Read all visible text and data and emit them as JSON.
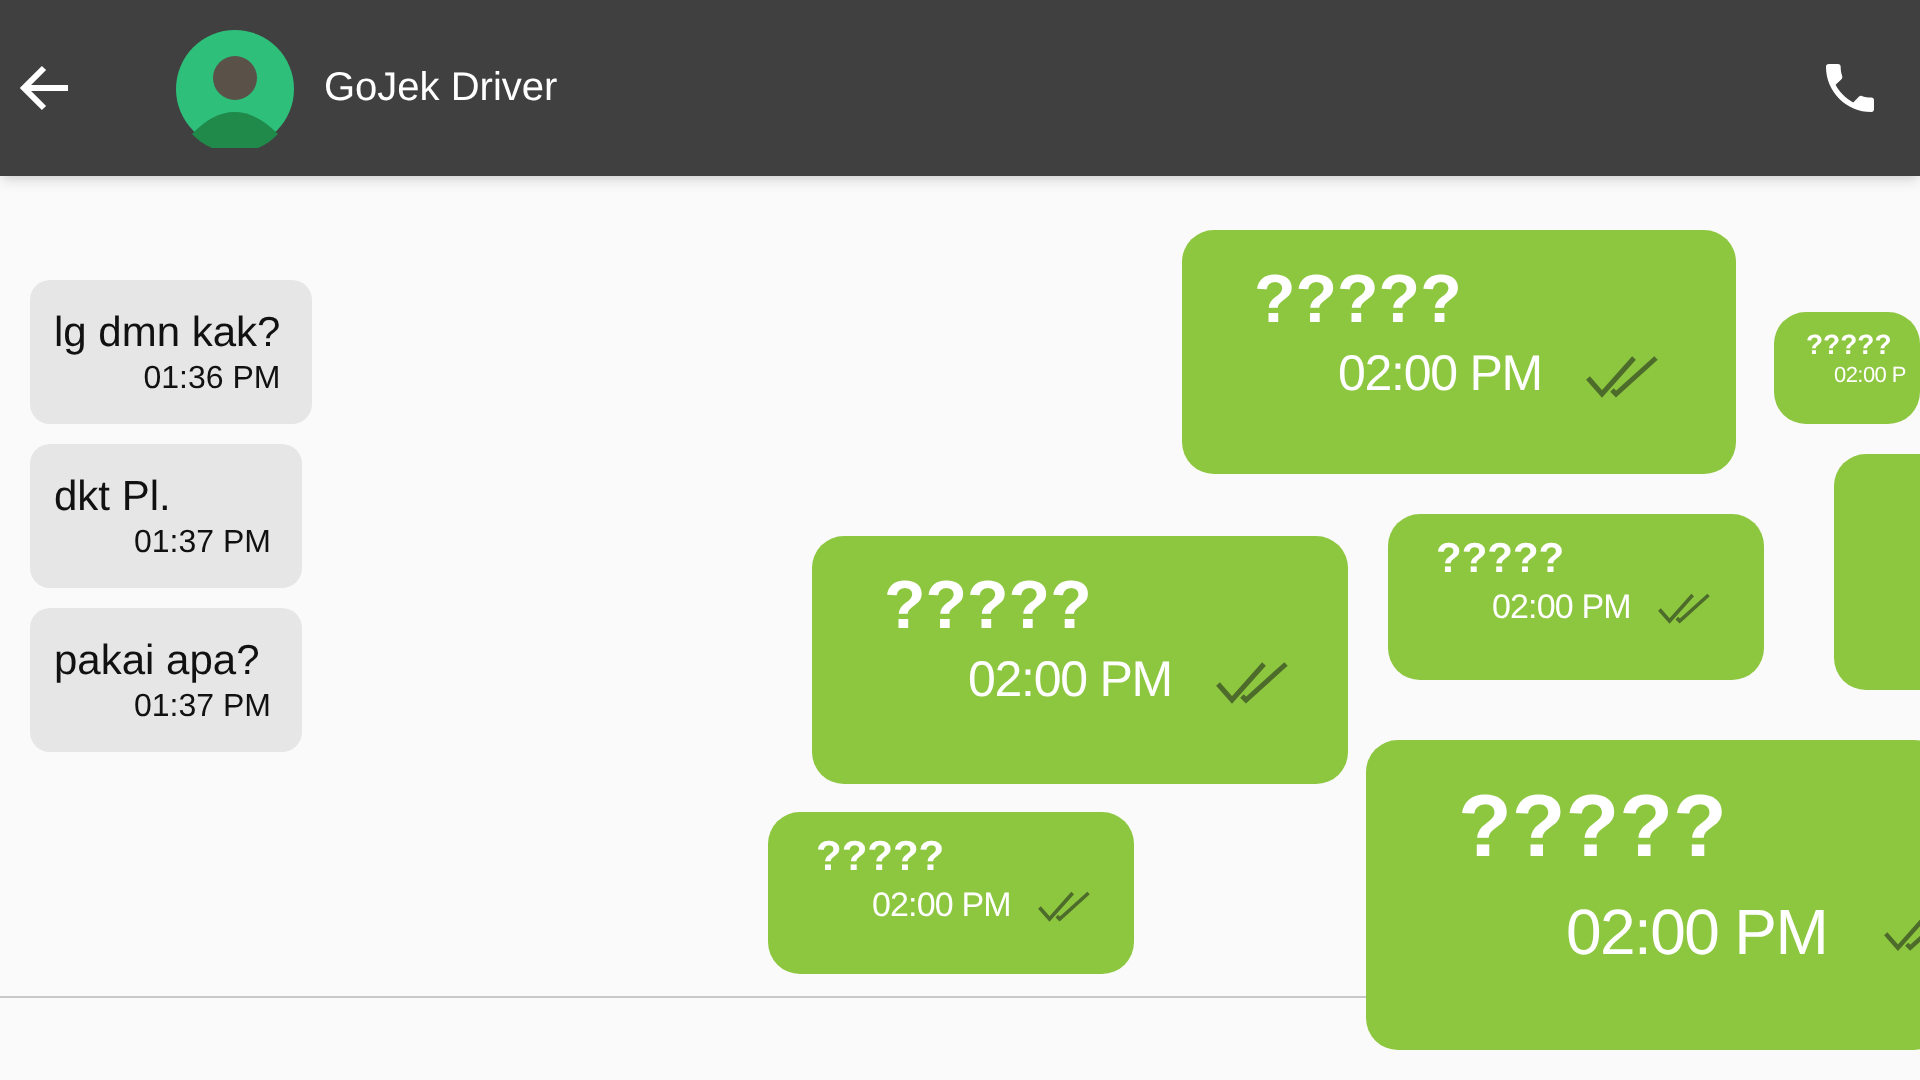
{
  "header": {
    "title": "GoJek Driver"
  },
  "received": [
    {
      "text": "lg dmn kak?",
      "time": "01:36 PM"
    },
    {
      "text": "dkt Pl.",
      "time": "01:37 PM"
    },
    {
      "text": "pakai apa?",
      "time": "01:37 PM"
    }
  ],
  "sent": [
    {
      "kind": "medium",
      "text": "?????",
      "time": "02:00 PM",
      "ticks": true
    },
    {
      "kind": "tiny",
      "text": "?????",
      "time": "02:00 P"
    },
    {
      "kind": "edge"
    },
    {
      "kind": "small",
      "text": "?????",
      "time": "02:00 PM",
      "ticks": true
    },
    {
      "kind": "medium",
      "text": "?????",
      "time": "02:00 PM",
      "ticks": true
    },
    {
      "kind": "small",
      "text": "?????",
      "time": "02:00 PM",
      "ticks": true
    },
    {
      "kind": "large",
      "text": "?????",
      "time": "02:00 PM",
      "ticks": true
    }
  ]
}
